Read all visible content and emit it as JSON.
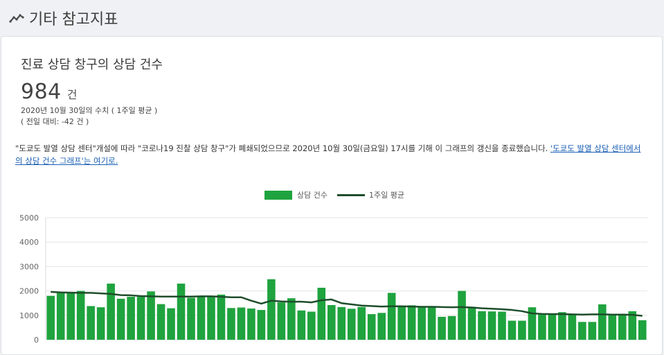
{
  "header": {
    "title": "기타 참고지표",
    "icon": "trend-line-icon"
  },
  "card": {
    "title": "진료 상담 창구의 상담 건수",
    "value": "984",
    "unit": "건",
    "date_line": "2020년 10월 30일의 수치 ( 1주일 평균 )",
    "diff_line": "( 전일 대비: -42 건 )",
    "notice_text": "\"도쿄도 발열 상담 센터\"개설에 따라 \"코로나19 진찰 상담 창구\"가 폐쇄되었으므로 2020년 10월 30일(금요일) 17시를 기해 이 그래프의 갱신을 종료했습니다. ",
    "notice_link": "'도쿄도 발열 상담 센터에서의 상담 건수 그래프'는 여기로."
  },
  "chart_data": {
    "type": "bar",
    "ylim": [
      0,
      5000
    ],
    "yticks": [
      0,
      1000,
      2000,
      3000,
      4000,
      5000
    ],
    "grid": true,
    "legend_position": "top",
    "series": [
      {
        "name": "상담 건수",
        "type": "bar",
        "color": "#1fa33e",
        "values": [
          1800,
          1950,
          1950,
          2000,
          1380,
          1330,
          2300,
          1680,
          1760,
          1760,
          1980,
          1460,
          1290,
          2300,
          1720,
          1780,
          1780,
          1850,
          1300,
          1320,
          1280,
          1220,
          2480,
          1530,
          1700,
          1200,
          1150,
          2130,
          1420,
          1340,
          1270,
          1340,
          1050,
          1100,
          1920,
          1360,
          1410,
          1370,
          1360,
          940,
          970,
          2000,
          1350,
          1170,
          1160,
          1150,
          780,
          780,
          1330,
          1060,
          1060,
          1130,
          1060,
          730,
          730,
          1450,
          1050,
          1060,
          1170,
          800
        ]
      },
      {
        "name": "1주일 평균",
        "type": "line",
        "color": "#1e4d2b",
        "values": [
          1960,
          1940,
          1930,
          1920,
          1920,
          1900,
          1880,
          1830,
          1820,
          1790,
          1780,
          1770,
          1770,
          1770,
          1770,
          1780,
          1780,
          1760,
          1740,
          1740,
          1600,
          1480,
          1600,
          1570,
          1560,
          1560,
          1530,
          1620,
          1650,
          1500,
          1450,
          1400,
          1380,
          1360,
          1370,
          1370,
          1360,
          1350,
          1350,
          1340,
          1330,
          1340,
          1320,
          1290,
          1270,
          1250,
          1220,
          1170,
          1080,
          1060,
          1050,
          1050,
          1040,
          1030,
          1040,
          1040,
          1030,
          1030,
          1020,
          980
        ]
      }
    ]
  }
}
